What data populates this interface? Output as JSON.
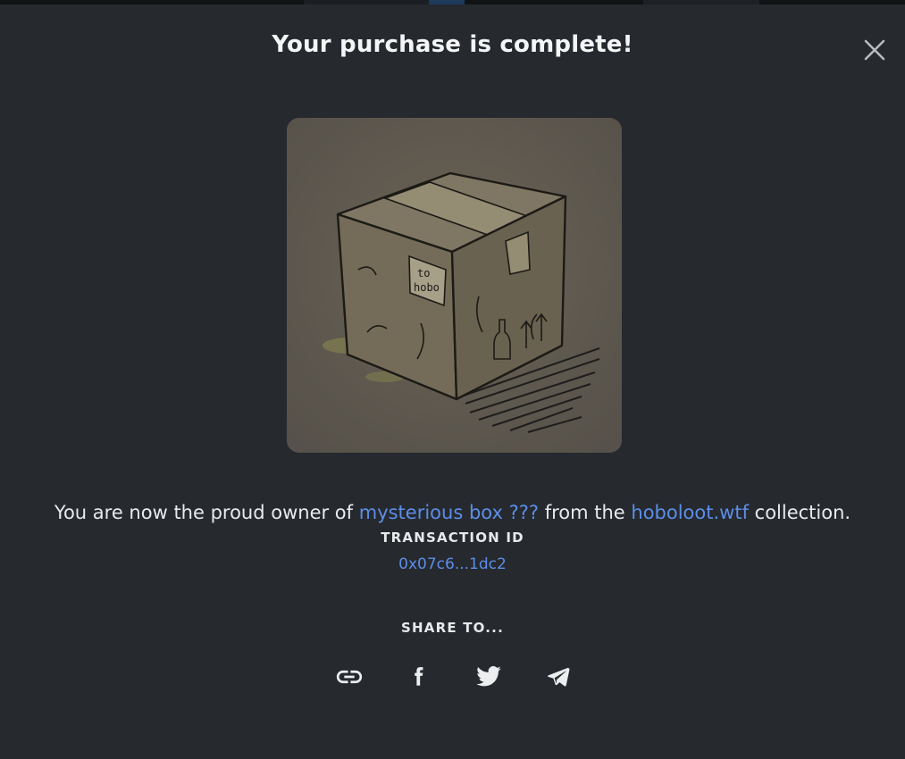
{
  "modal": {
    "title": "Your purchase is complete!",
    "close_icon": "close-icon"
  },
  "artwork": {
    "box_label_line1": "to",
    "box_label_line2": "hobo"
  },
  "message": {
    "prefix": "You are now the proud owner of ",
    "item_name": "mysterious box ???",
    "middle": " from the ",
    "collection_name": "hoboloot.wtf",
    "suffix": " collection."
  },
  "transaction": {
    "label": "TRANSACTION ID",
    "id": "0x07c6...1dc2"
  },
  "share": {
    "label": "SHARE TO...",
    "icons": [
      "link-icon",
      "facebook-icon",
      "twitter-icon",
      "telegram-icon"
    ]
  },
  "colors": {
    "background": "#26292e",
    "link": "#5c8ee8",
    "text": "#e9eaec"
  }
}
